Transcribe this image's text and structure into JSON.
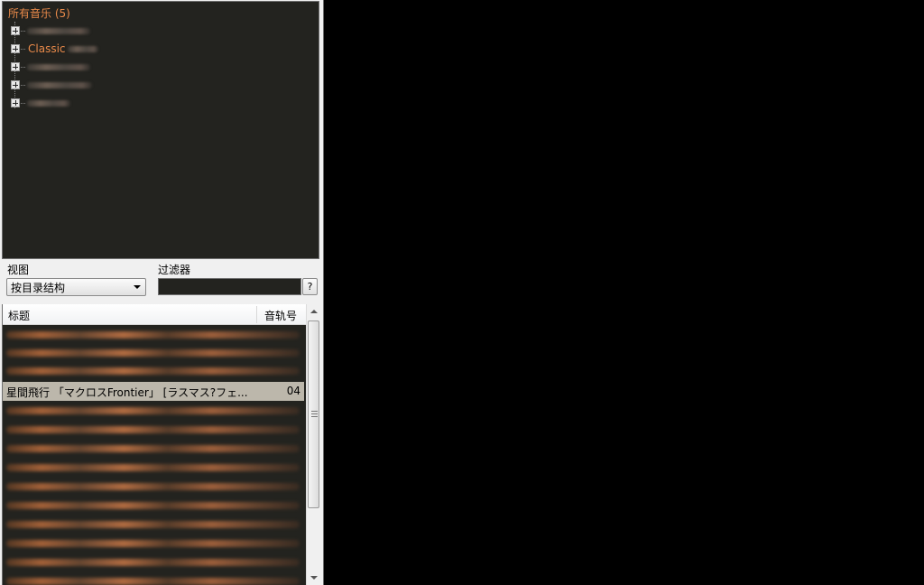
{
  "tree": {
    "root_label": "所有音乐 (5)",
    "nodes": [
      {
        "label": ""
      },
      {
        "label": "Classic"
      },
      {
        "label": ""
      },
      {
        "label": ""
      },
      {
        "label": ""
      }
    ]
  },
  "controls": {
    "view_label": "视图",
    "view_value": "按目录结构",
    "filter_label": "过滤器",
    "filter_value": "",
    "help_label": "?"
  },
  "track_list": {
    "columns": {
      "title": "标题",
      "track_number": "音轨号"
    },
    "selected_row": {
      "title": "星間飛行 「マクロスFrontier」 [ラスマス?フェ...",
      "track_number": "04"
    }
  },
  "colors": {
    "panel_bg": "#23231f",
    "accent_orange": "#e98a4a",
    "selection": "#bcb7ab",
    "visualizer_bg": "#000000"
  }
}
